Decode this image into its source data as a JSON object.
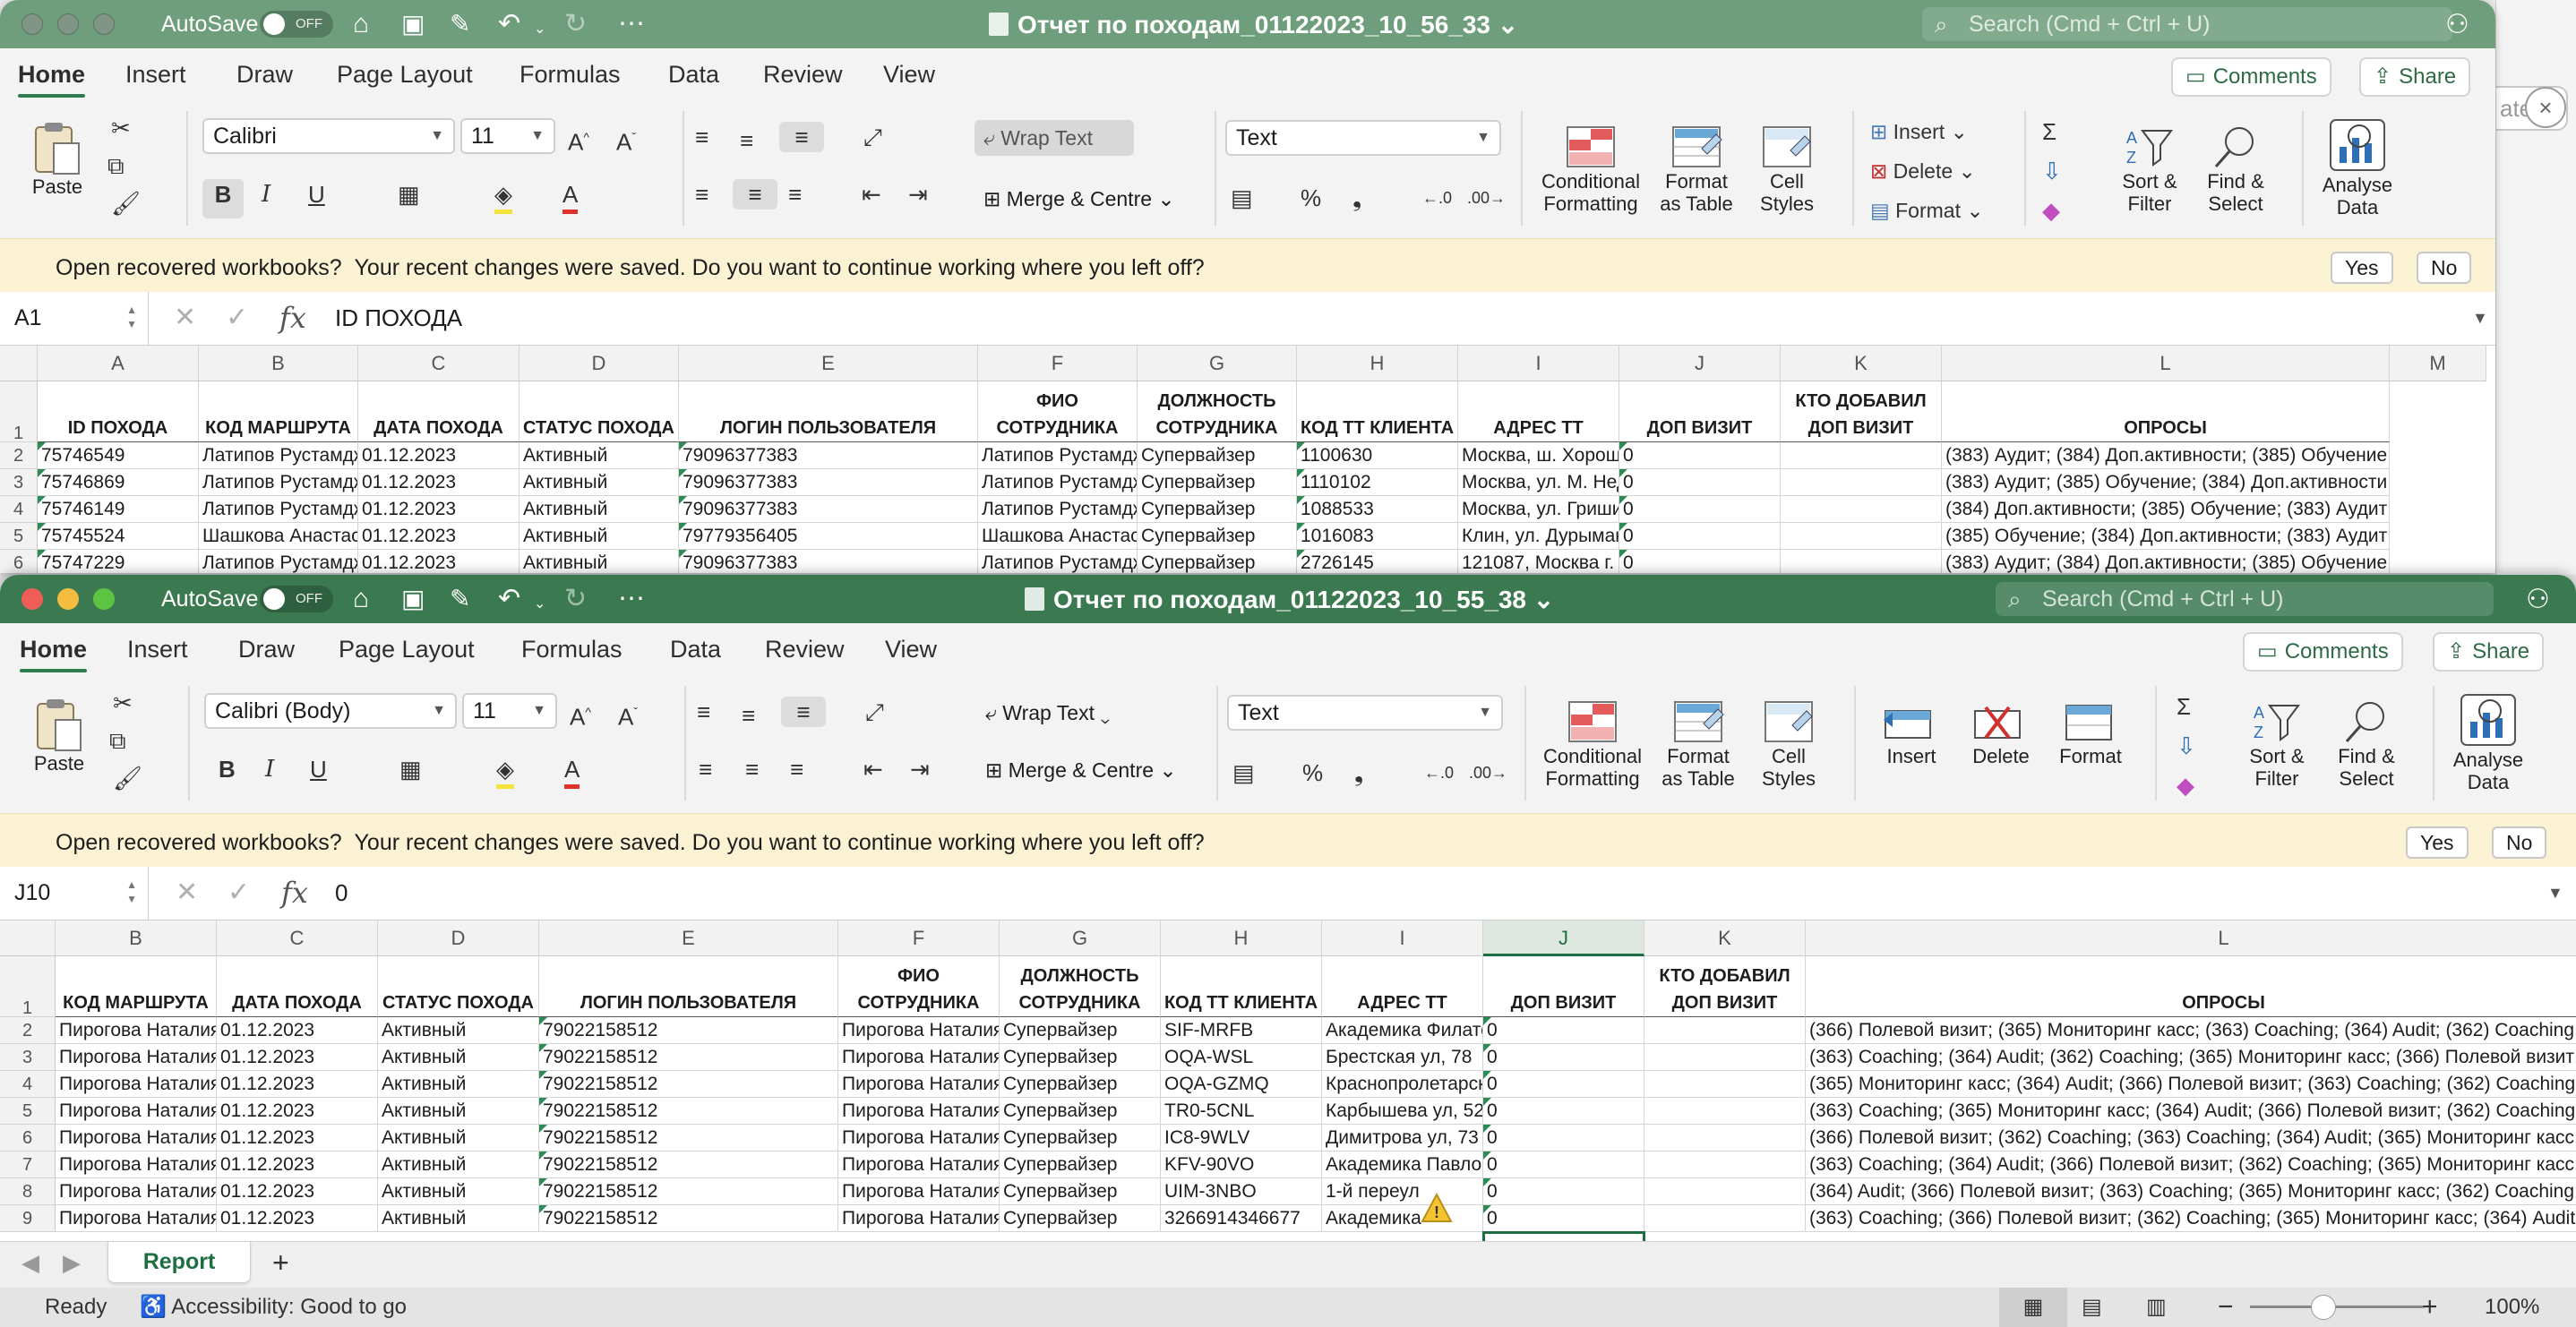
{
  "back_window": {
    "autosave_label": "AutoSave",
    "toggle_state": "OFF",
    "title": "Отчет по походам_01122023_10_56_33",
    "search_placeholder": "Search (Cmd + Ctrl + U)",
    "tabs": [
      "Home",
      "Insert",
      "Draw",
      "Page Layout",
      "Formulas",
      "Data",
      "Review",
      "View"
    ],
    "comments_label": "Comments",
    "share_label": "Share",
    "ribbon": {
      "paste": "Paste",
      "font_name": "Calibri",
      "font_size": "11",
      "wrap_text": "Wrap Text",
      "merge": "Merge & Centre",
      "number_format": "Text",
      "cond_format": [
        "Conditional",
        "Formatting"
      ],
      "format_table": [
        "Format",
        "as Table"
      ],
      "cell_styles": [
        "Cell",
        "Styles"
      ],
      "insert": "Insert",
      "delete": "Delete",
      "format": "Format",
      "sort_filter": [
        "Sort &",
        "Filter"
      ],
      "find_select": [
        "Find &",
        "Select"
      ],
      "analyse": [
        "Analyse",
        "Data"
      ]
    },
    "message": {
      "title": "Open recovered workbooks?",
      "text": "Your recent changes were saved. Do you want to continue working where you left off?",
      "yes": "Yes",
      "no": "No"
    },
    "name_box": "A1",
    "formula": "ID ПОХОДА",
    "columns": [
      "A",
      "B",
      "C",
      "D",
      "E",
      "F",
      "G",
      "H",
      "I",
      "J",
      "K",
      "L",
      "M"
    ],
    "row_numbers": [
      "1",
      "2",
      "3",
      "4",
      "5",
      "6"
    ],
    "headers": [
      "ID ПОХОДА",
      "КОД МАРШРУТА",
      "ДАТА ПОХОДА",
      "СТАТУС ПОХОДА",
      "ЛОГИН ПОЛЬЗОВАТЕЛЯ",
      "ФИО СОТРУДНИКА",
      "ДОЛЖНОСТЬ СОТРУДНИКА",
      "КОД ТТ КЛИЕНТА",
      "АДРЕС ТТ",
      "ДОП ВИЗИТ",
      "КТО ДОБАВИЛ ДОП ВИЗИТ",
      "ОПРОСЫ"
    ],
    "rows": [
      [
        "75746549",
        "Латипов Рустамдж",
        "01.12.2023",
        "Активный",
        "79096377383",
        "Латипов Рустамдж",
        "Супервайзер",
        "1100630",
        "Москва, ш. Хороше",
        "0",
        "",
        "(383) Аудит; (384) Доп.активности; (385) Обучение;"
      ],
      [
        "75746869",
        "Латипов Рустамдж",
        "01.12.2023",
        "Активный",
        "79096377383",
        "Латипов Рустамдж",
        "Супервайзер",
        "1110102",
        "Москва, ул. М. Нед",
        "0",
        "",
        "(383) Аудит; (385) Обучение; (384) Доп.активности;"
      ],
      [
        "75746149",
        "Латипов Рустамдж",
        "01.12.2023",
        "Активный",
        "79096377383",
        "Латипов Рустамдж",
        "Супервайзер",
        "1088533",
        "Москва, ул. Гриши",
        "0",
        "",
        "(384) Доп.активности; (385) Обучение; (383) Аудит;"
      ],
      [
        "75745524",
        "Шашкова Анастаси",
        "01.12.2023",
        "Активный",
        "79779356405",
        "Шашкова Анастаси",
        "Супервайзер",
        "1016083",
        "Клин, ул. Дурыман",
        "0",
        "",
        "(385) Обучение; (384) Доп.активности; (383) Аудит;"
      ],
      [
        "75747229",
        "Латипов Рустамдж",
        "01.12.2023",
        "Активный",
        "79096377383",
        "Латипов Рустамдж",
        "Супервайзер",
        "2726145",
        "121087, Москва г.",
        "0",
        "",
        "(383) Аудит; (384) Доп.активности; (385) Обучение;"
      ]
    ]
  },
  "front_window": {
    "autosave_label": "AutoSave",
    "toggle_state": "OFF",
    "title": "Отчет по походам_01122023_10_55_38",
    "search_placeholder": "Search (Cmd + Ctrl + U)",
    "tabs": [
      "Home",
      "Insert",
      "Draw",
      "Page Layout",
      "Formulas",
      "Data",
      "Review",
      "View"
    ],
    "comments_label": "Comments",
    "share_label": "Share",
    "ribbon": {
      "paste": "Paste",
      "font_name": "Calibri (Body)",
      "font_size": "11",
      "wrap_text": "Wrap Text",
      "merge": "Merge & Centre",
      "number_format": "Text",
      "cond_format": [
        "Conditional",
        "Formatting"
      ],
      "format_table": [
        "Format",
        "as Table"
      ],
      "cell_styles": [
        "Cell",
        "Styles"
      ],
      "insert": "Insert",
      "delete": "Delete",
      "format": "Format",
      "sort_filter": [
        "Sort &",
        "Filter"
      ],
      "find_select": [
        "Find &",
        "Select"
      ],
      "analyse": [
        "Analyse",
        "Data"
      ]
    },
    "message": {
      "title": "Open recovered workbooks?",
      "text": "Your recent changes were saved. Do you want to continue working where you left off?",
      "yes": "Yes",
      "no": "No"
    },
    "name_box": "J10",
    "formula": "0",
    "columns": [
      "B",
      "C",
      "D",
      "E",
      "F",
      "G",
      "H",
      "I",
      "J",
      "K",
      "L"
    ],
    "row_numbers": [
      "1",
      "2",
      "3",
      "4",
      "5",
      "6",
      "7",
      "8",
      "9"
    ],
    "headers": [
      "КОД МАРШРУТА",
      "ДАТА ПОХОДА",
      "СТАТУС ПОХОДА",
      "ЛОГИН ПОЛЬЗОВАТЕЛЯ",
      "ФИО СОТРУДНИКА",
      "ДОЛЖНОСТЬ СОТРУДНИКА",
      "КОД ТТ КЛИЕНТА",
      "АДРЕС ТТ",
      "ДОП ВИЗИТ",
      "КТО ДОБАВИЛ ДОП ВИЗИТ",
      "ОПРОСЫ"
    ],
    "rows": [
      [
        "Пирогова Наталия",
        "01.12.2023",
        "Активный",
        "79022158512",
        "Пирогова Наталия",
        "Супервайзер",
        "SIF-MRFB",
        "Академика Филато",
        "0",
        "",
        "(366) Полевой визит; (365) Мониторинг касс; (363) Coaching; (364) Audit; (362) Coaching;"
      ],
      [
        "Пирогова Наталия",
        "01.12.2023",
        "Активный",
        "79022158512",
        "Пирогова Наталия",
        "Супервайзер",
        "OQA-WSL",
        "Брестская ул, 78",
        "0",
        "",
        "(363) Coaching; (364) Audit; (362) Coaching; (365) Мониторинг касс; (366) Полевой визит;"
      ],
      [
        "Пирогова Наталия",
        "01.12.2023",
        "Активный",
        "79022158512",
        "Пирогова Наталия",
        "Супервайзер",
        "OQA-GZMQ",
        "Краснопролетарск",
        "0",
        "",
        "(365) Мониторинг касс; (364) Audit; (366) Полевой визит; (363) Coaching; (362) Coaching;"
      ],
      [
        "Пирогова Наталия",
        "01.12.2023",
        "Активный",
        "79022158512",
        "Пирогова Наталия",
        "Супервайзер",
        "TR0-5CNL",
        "Карбышева ул, 52",
        "0",
        "",
        "(363) Coaching; (365) Мониторинг касс; (364) Audit; (366) Полевой визит; (362) Coaching;"
      ],
      [
        "Пирогова Наталия",
        "01.12.2023",
        "Активный",
        "79022158512",
        "Пирогова Наталия",
        "Супервайзер",
        "IC8-9WLV",
        "Димитрова ул, 73",
        "0",
        "",
        "(366) Полевой визит; (362) Coaching; (363) Coaching; (364) Audit; (365) Мониторинг касс;"
      ],
      [
        "Пирогова Наталия",
        "01.12.2023",
        "Активный",
        "79022158512",
        "Пирогова Наталия",
        "Супервайзер",
        "KFV-90VO",
        "Академика Павлов",
        "0",
        "",
        "(363) Coaching; (364) Audit; (366) Полевой визит; (362) Coaching; (365) Мониторинг касс;"
      ],
      [
        "Пирогова Наталия",
        "01.12.2023",
        "Активный",
        "79022158512",
        "Пирогова Наталия",
        "Супервайзер",
        "UIM-3NBO",
        "1-й переул",
        "0",
        "",
        "(364) Audit; (366) Полевой визит; (363) Coaching; (365) Мониторинг касс; (362) Coaching;"
      ],
      [
        "Пирогова Наталия",
        "01.12.2023",
        "Активный",
        "79022158512",
        "Пирогова Наталия",
        "Супервайзер",
        "3266914346677",
        "Академика",
        "0",
        "",
        "(363) Coaching; (366) Полевой визит; (362) Coaching; (365) Мониторинг касс; (364) Audit;"
      ]
    ],
    "sheet_tab": "Report",
    "status": {
      "ready": "Ready",
      "accessibility": "Accessibility: Good to go",
      "zoom": "100%"
    }
  },
  "colors": {
    "excel_green": "#3b7a51",
    "inactive_green": "#6e9e7c",
    "accent_dark_green": "#1d6f42",
    "message_bar": "#fbf2d4"
  }
}
